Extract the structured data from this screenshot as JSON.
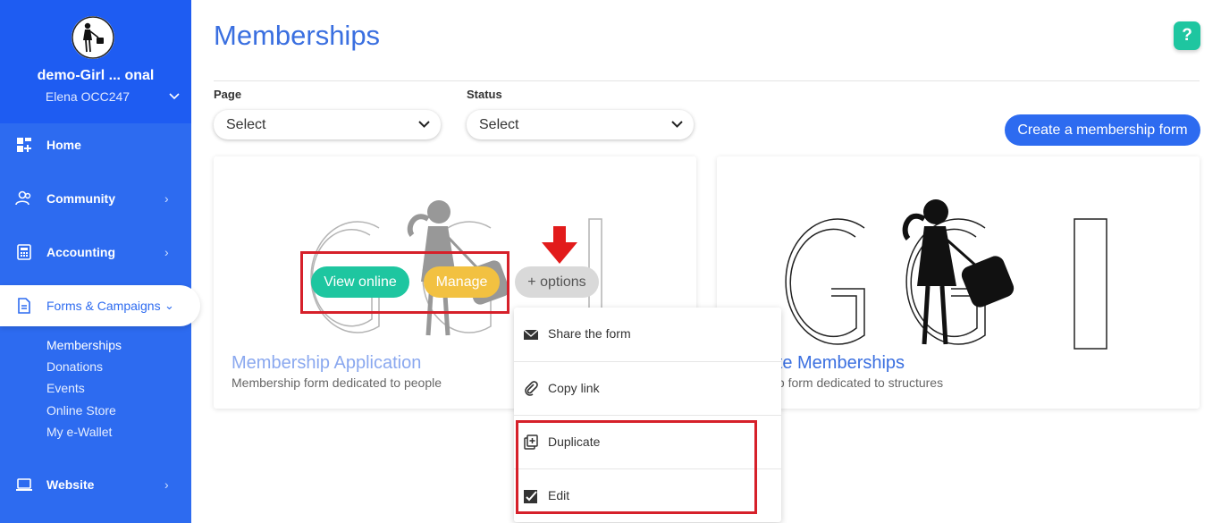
{
  "sidebar": {
    "org_name": "demo-Girl ... onal",
    "user_name": "Elena OCC247",
    "nav": {
      "home": "Home",
      "community": "Community",
      "accounting": "Accounting",
      "forms": "Forms & Campaigns",
      "website": "Website"
    },
    "sub": {
      "memberships": "Memberships",
      "donations": "Donations",
      "events": "Events",
      "online_store": "Online Store",
      "ewallet": "My e-Wallet"
    }
  },
  "header": {
    "title": "Memberships",
    "help": "?"
  },
  "filters": {
    "page_label": "Page",
    "page_value": "Select",
    "status_label": "Status",
    "status_value": "Select"
  },
  "actions": {
    "create": "Create a membership form"
  },
  "cards": [
    {
      "title": "Membership Application",
      "desc": "Membership form dedicated to people"
    },
    {
      "title": "rate Memberships",
      "desc": "ship form dedicated to structures"
    }
  ],
  "card_buttons": {
    "view_online": "View online",
    "manage": "Manage",
    "options": "+ options"
  },
  "options_menu": {
    "share": "Share the form",
    "copy": "Copy link",
    "duplicate": "Duplicate",
    "edit": "Edit"
  },
  "colors": {
    "brand": "#2d6bf0",
    "view_online": "#1ec6a0",
    "manage": "#f2c141",
    "options": "#d9d9d9",
    "highlight": "#d6202a"
  }
}
